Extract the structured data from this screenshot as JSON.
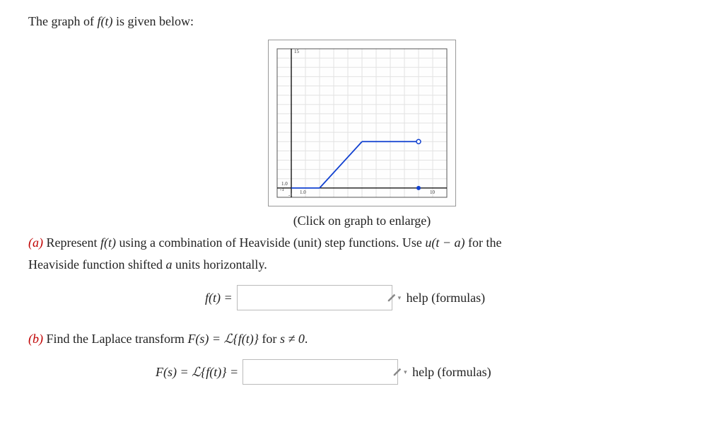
{
  "intro_pre": "The graph of ",
  "intro_fn": "f(t)",
  "intro_post": " is given below:",
  "caption": "(Click on graph to enlarge)",
  "partA": {
    "label": "(a)",
    "text_pre": " Represent ",
    "text_fn": "f(t)",
    "text_mid": " using a combination of Heaviside (unit) step functions. Use ",
    "text_ut": "u(t − a)",
    "text_post1": " for the",
    "text_line2_pre": "Heaviside function shifted ",
    "text_line2_var": "a",
    "text_line2_post": " units horizontally.",
    "lhs": "f(t) = ",
    "help": "help (formulas)"
  },
  "partB": {
    "label": "(b)",
    "text_pre": " Find the Laplace transform ",
    "text_Fs": "F(s) = ℒ{f(t)}",
    "text_mid": " for ",
    "text_cond": "s ≠ 0",
    "text_end": ".",
    "lhs_F": "F(s) = ",
    "lhs_L": "ℒ{f(t)} = ",
    "help": "help (formulas)"
  },
  "chart_data": {
    "type": "line",
    "x_range": [
      -1,
      11
    ],
    "y_range": [
      -1,
      15
    ],
    "x_ticks": [
      1,
      10
    ],
    "y_ticks": [
      1,
      15
    ],
    "x_tick_label_at_1": "1.0",
    "series": [
      {
        "name": "f(t)",
        "segments": [
          {
            "from": [
              0,
              0
            ],
            "to": [
              2,
              0
            ]
          },
          {
            "from": [
              2,
              0
            ],
            "to": [
              5,
              5
            ]
          },
          {
            "from": [
              5,
              5
            ],
            "to": [
              9,
              5
            ],
            "open_end": true
          }
        ],
        "points_on_axis": [
          {
            "x": 9,
            "y": 0
          }
        ]
      }
    ]
  }
}
